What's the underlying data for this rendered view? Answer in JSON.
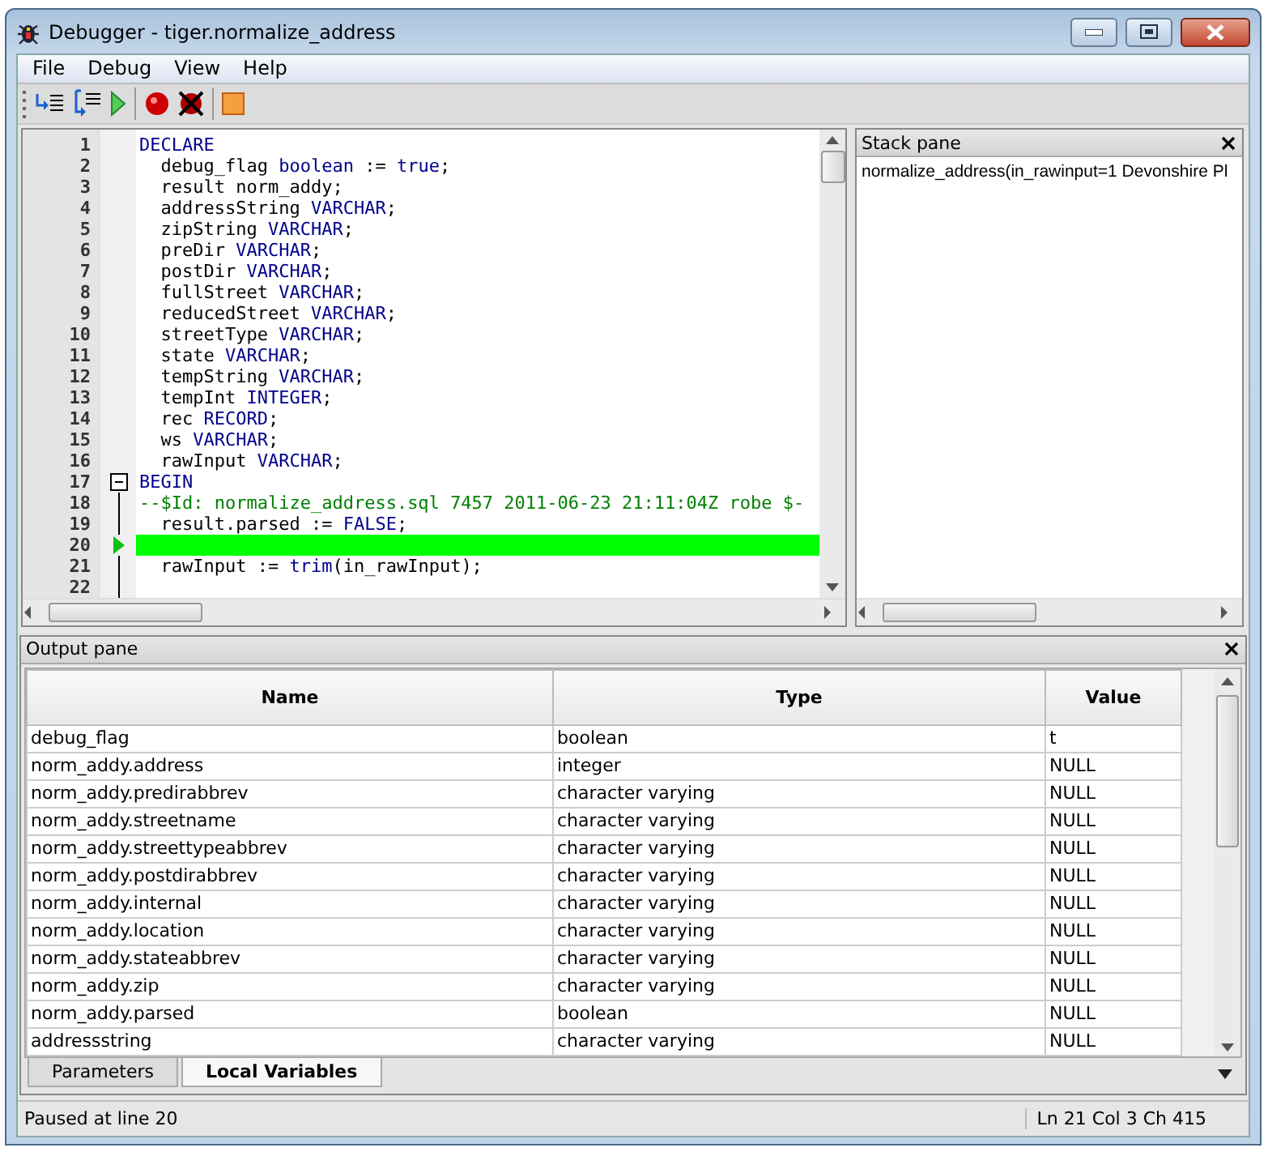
{
  "window": {
    "title": "Debugger - tiger.normalize_address"
  },
  "menu": [
    "File",
    "Debug",
    "View",
    "Help"
  ],
  "editor": {
    "lines": [
      {
        "number": "1",
        "current": false,
        "fold_start": false,
        "segments": [
          {
            "kind": "kw",
            "text": "DECLARE"
          }
        ]
      },
      {
        "number": "2",
        "current": false,
        "fold_start": false,
        "segments": [
          {
            "kind": "plain",
            "text": "  debug_flag "
          },
          {
            "kind": "kw",
            "text": "boolean"
          },
          {
            "kind": "plain",
            "text": " := "
          },
          {
            "kind": "kw",
            "text": "true"
          },
          {
            "kind": "plain",
            "text": ";"
          }
        ]
      },
      {
        "number": "3",
        "current": false,
        "fold_start": false,
        "segments": [
          {
            "kind": "plain",
            "text": "  result norm_addy;"
          }
        ]
      },
      {
        "number": "4",
        "current": false,
        "fold_start": false,
        "segments": [
          {
            "kind": "plain",
            "text": "  addressString "
          },
          {
            "kind": "kw",
            "text": "VARCHAR"
          },
          {
            "kind": "plain",
            "text": ";"
          }
        ]
      },
      {
        "number": "5",
        "current": false,
        "fold_start": false,
        "segments": [
          {
            "kind": "plain",
            "text": "  zipString "
          },
          {
            "kind": "kw",
            "text": "VARCHAR"
          },
          {
            "kind": "plain",
            "text": ";"
          }
        ]
      },
      {
        "number": "6",
        "current": false,
        "fold_start": false,
        "segments": [
          {
            "kind": "plain",
            "text": "  preDir "
          },
          {
            "kind": "kw",
            "text": "VARCHAR"
          },
          {
            "kind": "plain",
            "text": ";"
          }
        ]
      },
      {
        "number": "7",
        "current": false,
        "fold_start": false,
        "segments": [
          {
            "kind": "plain",
            "text": "  postDir "
          },
          {
            "kind": "kw",
            "text": "VARCHAR"
          },
          {
            "kind": "plain",
            "text": ";"
          }
        ]
      },
      {
        "number": "8",
        "current": false,
        "fold_start": false,
        "segments": [
          {
            "kind": "plain",
            "text": "  fullStreet "
          },
          {
            "kind": "kw",
            "text": "VARCHAR"
          },
          {
            "kind": "plain",
            "text": ";"
          }
        ]
      },
      {
        "number": "9",
        "current": false,
        "fold_start": false,
        "segments": [
          {
            "kind": "plain",
            "text": "  reducedStreet "
          },
          {
            "kind": "kw",
            "text": "VARCHAR"
          },
          {
            "kind": "plain",
            "text": ";"
          }
        ]
      },
      {
        "number": "10",
        "current": false,
        "fold_start": false,
        "segments": [
          {
            "kind": "plain",
            "text": "  streetType "
          },
          {
            "kind": "kw",
            "text": "VARCHAR"
          },
          {
            "kind": "plain",
            "text": ";"
          }
        ]
      },
      {
        "number": "11",
        "current": false,
        "fold_start": false,
        "segments": [
          {
            "kind": "plain",
            "text": "  state "
          },
          {
            "kind": "kw",
            "text": "VARCHAR"
          },
          {
            "kind": "plain",
            "text": ";"
          }
        ]
      },
      {
        "number": "12",
        "current": false,
        "fold_start": false,
        "segments": [
          {
            "kind": "plain",
            "text": "  tempString "
          },
          {
            "kind": "kw",
            "text": "VARCHAR"
          },
          {
            "kind": "plain",
            "text": ";"
          }
        ]
      },
      {
        "number": "13",
        "current": false,
        "fold_start": false,
        "segments": [
          {
            "kind": "plain",
            "text": "  tempInt "
          },
          {
            "kind": "kw",
            "text": "INTEGER"
          },
          {
            "kind": "plain",
            "text": ";"
          }
        ]
      },
      {
        "number": "14",
        "current": false,
        "fold_start": false,
        "segments": [
          {
            "kind": "plain",
            "text": "  rec "
          },
          {
            "kind": "kw",
            "text": "RECORD"
          },
          {
            "kind": "plain",
            "text": ";"
          }
        ]
      },
      {
        "number": "15",
        "current": false,
        "fold_start": false,
        "segments": [
          {
            "kind": "plain",
            "text": "  ws "
          },
          {
            "kind": "kw",
            "text": "VARCHAR"
          },
          {
            "kind": "plain",
            "text": ";"
          }
        ]
      },
      {
        "number": "16",
        "current": false,
        "fold_start": false,
        "segments": [
          {
            "kind": "plain",
            "text": "  rawInput "
          },
          {
            "kind": "kw",
            "text": "VARCHAR"
          },
          {
            "kind": "plain",
            "text": ";"
          }
        ]
      },
      {
        "number": "17",
        "current": false,
        "fold_start": true,
        "segments": [
          {
            "kind": "kw",
            "text": "BEGIN"
          }
        ]
      },
      {
        "number": "18",
        "current": false,
        "fold_start": false,
        "segments": [
          {
            "kind": "comment",
            "text": "--$Id: normalize_address.sql 7457 2011-06-23 21:11:04Z robe $-"
          }
        ]
      },
      {
        "number": "19",
        "current": false,
        "fold_start": false,
        "segments": [
          {
            "kind": "plain",
            "text": "  result.parsed := "
          },
          {
            "kind": "kw",
            "text": "FALSE"
          },
          {
            "kind": "plain",
            "text": ";"
          }
        ]
      },
      {
        "number": "20",
        "current": true,
        "fold_start": false
      },
      {
        "number": "21",
        "current": false,
        "fold_start": false,
        "segments": [
          {
            "kind": "plain",
            "text": "  rawInput := "
          },
          {
            "kind": "kw",
            "text": "trim"
          },
          {
            "kind": "plain",
            "text": "(in_rawInput);"
          }
        ]
      },
      {
        "number": "22",
        "current": false,
        "fold_start": false
      }
    ]
  },
  "stack_pane": {
    "title": "Stack pane",
    "frames": [
      "normalize_address(in_rawinput=1 Devonshire Pl"
    ]
  },
  "output_pane": {
    "title": "Output pane",
    "table": {
      "columns": [
        "Name",
        "Type",
        "Value"
      ],
      "rows": [
        [
          "debug_flag",
          "boolean",
          "t"
        ],
        [
          "norm_addy.address",
          "integer",
          "NULL"
        ],
        [
          "norm_addy.predirabbrev",
          "character varying",
          "NULL"
        ],
        [
          "norm_addy.streetname",
          "character varying",
          "NULL"
        ],
        [
          "norm_addy.streettypeabbrev",
          "character varying",
          "NULL"
        ],
        [
          "norm_addy.postdirabbrev",
          "character varying",
          "NULL"
        ],
        [
          "norm_addy.internal",
          "character varying",
          "NULL"
        ],
        [
          "norm_addy.location",
          "character varying",
          "NULL"
        ],
        [
          "norm_addy.stateabbrev",
          "character varying",
          "NULL"
        ],
        [
          "norm_addy.zip",
          "character varying",
          "NULL"
        ],
        [
          "norm_addy.parsed",
          "boolean",
          "NULL"
        ],
        [
          "addressstring",
          "character varying",
          "NULL"
        ]
      ]
    },
    "tabs": [
      {
        "label": "Parameters",
        "selected": false
      },
      {
        "label": "Local Variables",
        "selected": true
      }
    ]
  },
  "status_bar": {
    "message": "Paused at line 20",
    "position": "Ln 21 Col 3 Ch 415"
  }
}
